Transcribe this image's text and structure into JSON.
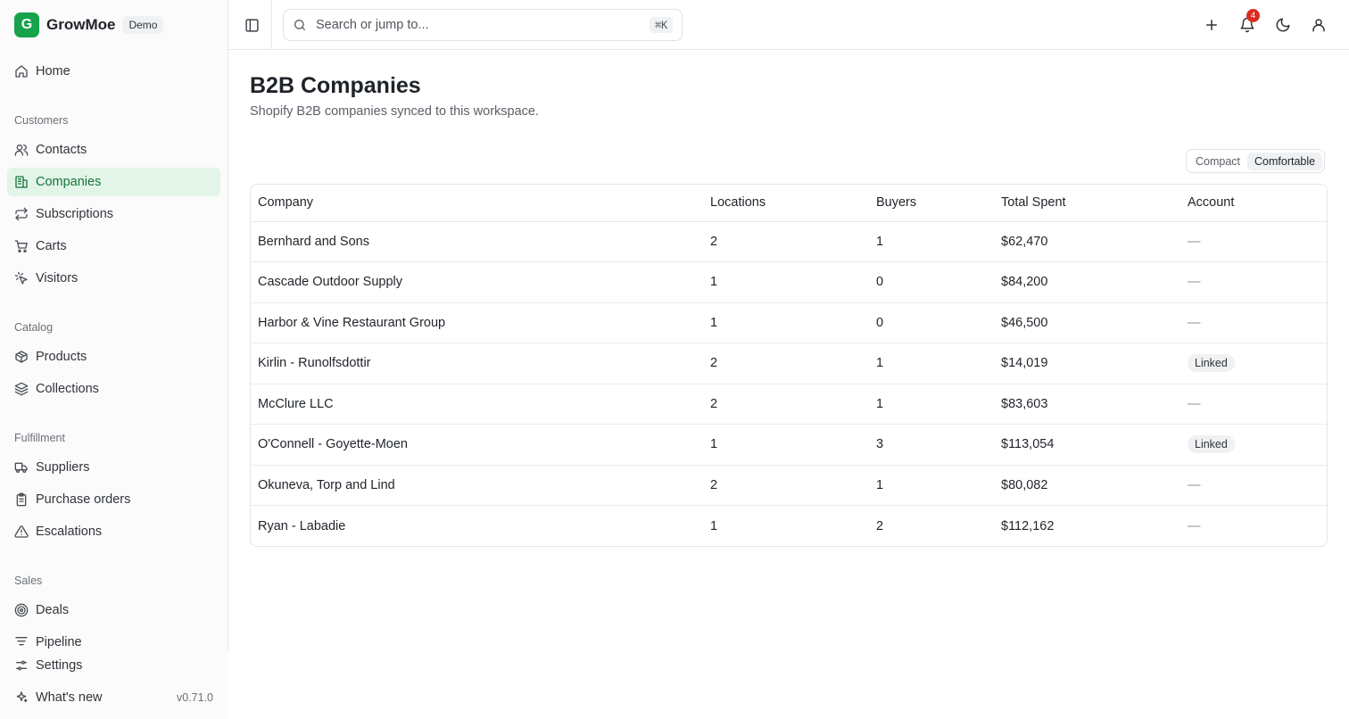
{
  "brand": {
    "logo_letter": "G",
    "name": "GrowMoe",
    "badge": "Demo"
  },
  "sidebar": {
    "home": "Home",
    "sections": {
      "customers": "Customers",
      "catalog": "Catalog",
      "fulfillment": "Fulfillment",
      "sales": "Sales"
    },
    "items": {
      "contacts": "Contacts",
      "companies": "Companies",
      "subscriptions": "Subscriptions",
      "carts": "Carts",
      "visitors": "Visitors",
      "products": "Products",
      "collections": "Collections",
      "suppliers": "Suppliers",
      "purchase_orders": "Purchase orders",
      "escalations": "Escalations",
      "deals": "Deals",
      "pipeline": "Pipeline"
    },
    "footer": {
      "settings": "Settings",
      "whats_new": "What's new",
      "version": "v0.71.0"
    },
    "active": "companies",
    "accent_color": "#16a34a"
  },
  "topbar": {
    "search_placeholder": "Search or jump to...",
    "search_shortcut": "⌘K",
    "notification_count": "4",
    "icons": [
      "sidebar-toggle-icon",
      "search-icon",
      "plus-icon",
      "bell-icon",
      "moon-icon",
      "user-icon"
    ]
  },
  "page": {
    "title": "B2B Companies",
    "subtitle": "Shopify B2B companies synced to this workspace."
  },
  "density": {
    "compact": "Compact",
    "comfortable": "Comfortable",
    "selected": "comfortable"
  },
  "table": {
    "headers": {
      "company": "Company",
      "locations": "Locations",
      "buyers": "Buyers",
      "total_spent": "Total Spent",
      "account": "Account"
    },
    "rows": [
      {
        "company": "Bernhard and Sons",
        "locations": "2",
        "buyers": "1",
        "total_spent": "$62,470",
        "account": "—"
      },
      {
        "company": "Cascade Outdoor Supply",
        "locations": "1",
        "buyers": "0",
        "total_spent": "$84,200",
        "account": "—"
      },
      {
        "company": "Harbor & Vine Restaurant Group",
        "locations": "1",
        "buyers": "0",
        "total_spent": "$46,500",
        "account": "—"
      },
      {
        "company": "Kirlin - Runolfsdottir",
        "locations": "2",
        "buyers": "1",
        "total_spent": "$14,019",
        "account": "Linked"
      },
      {
        "company": "McClure LLC",
        "locations": "2",
        "buyers": "1",
        "total_spent": "$83,603",
        "account": "—"
      },
      {
        "company": "O'Connell - Goyette-Moen",
        "locations": "1",
        "buyers": "3",
        "total_spent": "$113,054",
        "account": "Linked"
      },
      {
        "company": "Okuneva, Torp and Lind",
        "locations": "2",
        "buyers": "1",
        "total_spent": "$80,082",
        "account": "—"
      },
      {
        "company": "Ryan - Labadie",
        "locations": "1",
        "buyers": "2",
        "total_spent": "$112,162",
        "account": "—"
      }
    ]
  }
}
